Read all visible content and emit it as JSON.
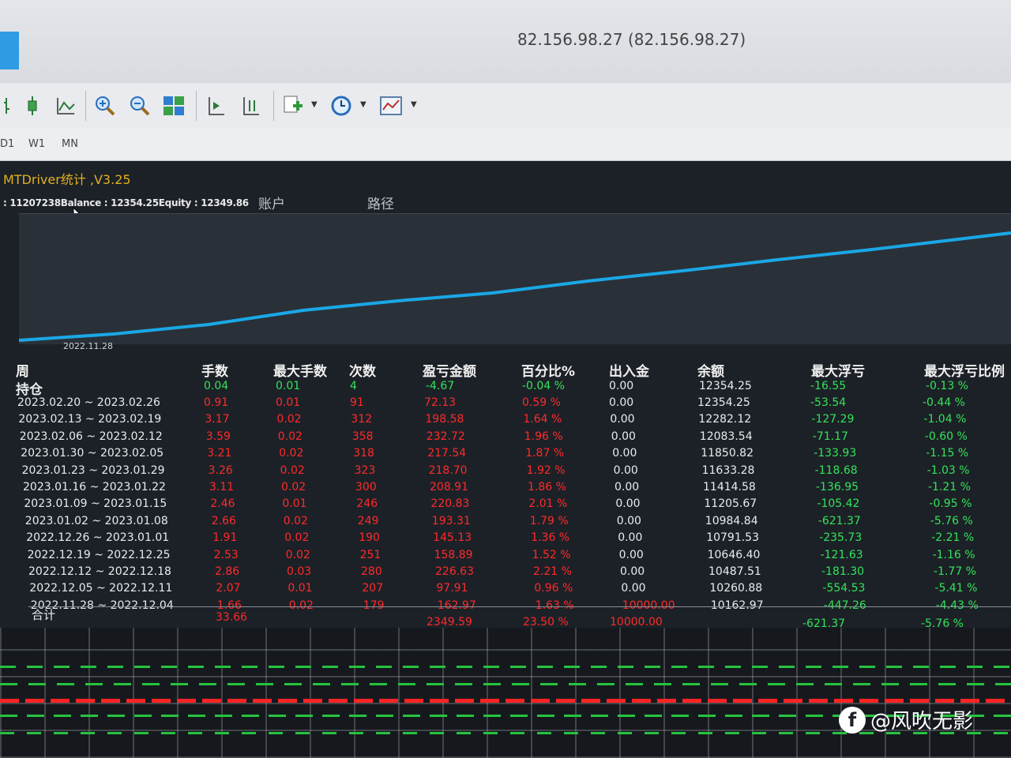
{
  "window": {
    "title": "82.156.98.27 (82.156.98.27)"
  },
  "toolbar": {
    "icons": [
      "candlestick-icon",
      "line-chart-icon",
      "zoom-in-icon",
      "zoom-out-icon",
      "tile-windows-icon",
      "chart-shift-icon",
      "autoscroll-icon",
      "new-indicator-icon",
      "clock-icon",
      "templates-icon"
    ]
  },
  "periods": [
    "D1",
    "W1",
    "MN"
  ],
  "indicator": {
    "name": "MTDriver统计 ,V3.25",
    "info": ": 11207238Balance : 12354.25Equity : 12349.86",
    "tabs": [
      "账户",
      "路径"
    ]
  },
  "chart": {
    "date_label": "2022.11.28"
  },
  "table": {
    "headers": {
      "week": "周",
      "lots": "手数",
      "max_lots": "最大手数",
      "trades": "次数",
      "profit": "盈亏金额",
      "percent": "百分比%",
      "deposit": "出入金",
      "balance": "余额",
      "max_drawdown": "最大浮亏",
      "max_drawdown_pct": "最大浮亏比例"
    },
    "holding": {
      "label": "持仓",
      "lots": "0.04",
      "max_lots": "0.01",
      "trades": "4",
      "profit": "-4.67",
      "percent": "-0.04 %",
      "deposit": "0.00",
      "balance": "12354.25",
      "max_drawdown": "-16.55",
      "max_drawdown_pct": "-0.13 %"
    },
    "rows": [
      {
        "week": "2023.02.20 ~ 2023.02.26",
        "lots": "0.91",
        "max_lots": "0.01",
        "trades": "91",
        "profit": "72.13",
        "percent": "0.59 %",
        "deposit": "0.00",
        "balance": "12354.25",
        "max_drawdown": "-53.54",
        "max_drawdown_pct": "-0.44 %"
      },
      {
        "week": "2023.02.13 ~ 2023.02.19",
        "lots": "3.17",
        "max_lots": "0.02",
        "trades": "312",
        "profit": "198.58",
        "percent": "1.64 %",
        "deposit": "0.00",
        "balance": "12282.12",
        "max_drawdown": "-127.29",
        "max_drawdown_pct": "-1.04 %"
      },
      {
        "week": "2023.02.06 ~ 2023.02.12",
        "lots": "3.59",
        "max_lots": "0.02",
        "trades": "358",
        "profit": "232.72",
        "percent": "1.96 %",
        "deposit": "0.00",
        "balance": "12083.54",
        "max_drawdown": "-71.17",
        "max_drawdown_pct": "-0.60 %"
      },
      {
        "week": "2023.01.30 ~ 2023.02.05",
        "lots": "3.21",
        "max_lots": "0.02",
        "trades": "318",
        "profit": "217.54",
        "percent": "1.87 %",
        "deposit": "0.00",
        "balance": "11850.82",
        "max_drawdown": "-133.93",
        "max_drawdown_pct": "-1.15 %"
      },
      {
        "week": "2023.01.23 ~ 2023.01.29",
        "lots": "3.26",
        "max_lots": "0.02",
        "trades": "323",
        "profit": "218.70",
        "percent": "1.92 %",
        "deposit": "0.00",
        "balance": "11633.28",
        "max_drawdown": "-118.68",
        "max_drawdown_pct": "-1.03 %"
      },
      {
        "week": "2023.01.16 ~ 2023.01.22",
        "lots": "3.11",
        "max_lots": "0.02",
        "trades": "300",
        "profit": "208.91",
        "percent": "1.86 %",
        "deposit": "0.00",
        "balance": "11414.58",
        "max_drawdown": "-136.95",
        "max_drawdown_pct": "-1.21 %"
      },
      {
        "week": "2023.01.09 ~ 2023.01.15",
        "lots": "2.46",
        "max_lots": "0.01",
        "trades": "246",
        "profit": "220.83",
        "percent": "2.01 %",
        "deposit": "0.00",
        "balance": "11205.67",
        "max_drawdown": "-105.42",
        "max_drawdown_pct": "-0.95 %"
      },
      {
        "week": "2023.01.02 ~ 2023.01.08",
        "lots": "2.66",
        "max_lots": "0.02",
        "trades": "249",
        "profit": "193.31",
        "percent": "1.79 %",
        "deposit": "0.00",
        "balance": "10984.84",
        "max_drawdown": "-621.37",
        "max_drawdown_pct": "-5.76 %"
      },
      {
        "week": "2022.12.26 ~ 2023.01.01",
        "lots": "1.91",
        "max_lots": "0.02",
        "trades": "190",
        "profit": "145.13",
        "percent": "1.36 %",
        "deposit": "0.00",
        "balance": "10791.53",
        "max_drawdown": "-235.73",
        "max_drawdown_pct": "-2.21 %"
      },
      {
        "week": "2022.12.19 ~ 2022.12.25",
        "lots": "2.53",
        "max_lots": "0.02",
        "trades": "251",
        "profit": "158.89",
        "percent": "1.52 %",
        "deposit": "0.00",
        "balance": "10646.40",
        "max_drawdown": "-121.63",
        "max_drawdown_pct": "-1.16 %"
      },
      {
        "week": "2022.12.12 ~ 2022.12.18",
        "lots": "2.86",
        "max_lots": "0.03",
        "trades": "280",
        "profit": "226.63",
        "percent": "2.21 %",
        "deposit": "0.00",
        "balance": "10487.51",
        "max_drawdown": "-181.30",
        "max_drawdown_pct": "-1.77 %"
      },
      {
        "week": "2022.12.05 ~ 2022.12.11",
        "lots": "2.07",
        "max_lots": "0.01",
        "trades": "207",
        "profit": "97.91",
        "percent": "0.96 %",
        "deposit": "0.00",
        "balance": "10260.88",
        "max_drawdown": "-554.53",
        "max_drawdown_pct": "-5.41 %"
      },
      {
        "week": "2022.11.28 ~ 2022.12.04",
        "lots": "1.66",
        "max_lots": "0.02",
        "trades": "179",
        "profit": "162.97",
        "percent": "1.63 %",
        "deposit": "10000.00",
        "balance": "10162.97",
        "max_drawdown": "-447.26",
        "max_drawdown_pct": "-4.43 %"
      }
    ],
    "total": {
      "label": "合计",
      "lots": "33.66",
      "profit": "2349.59",
      "percent": "23.50 %",
      "deposit": "10000.00",
      "max_drawdown": "-621.37",
      "max_drawdown_pct": "-5.76 %"
    }
  },
  "watermark": {
    "icon": "fb-logo-icon",
    "text": "@风吹无影"
  },
  "colors": {
    "balance_line": "#1aa7e6",
    "positive": "#33e35a",
    "negative": "#ff2a2a",
    "indicator_title": "#e0b120"
  }
}
